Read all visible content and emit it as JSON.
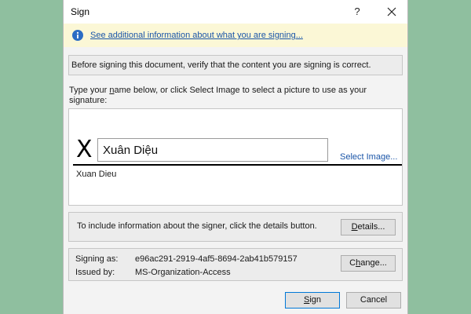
{
  "window": {
    "title": "Sign",
    "help_glyph": "?",
    "close_icon": "close-icon"
  },
  "infobar": {
    "link_text": "See additional information about what you are signing..."
  },
  "verify": {
    "text": "Before signing this document, verify that the content you are signing is correct."
  },
  "instructions": {
    "part1": "Type your ",
    "underlined": "n",
    "part2": "ame below, or click Select Image to select a picture to use as your signature:"
  },
  "signature": {
    "x_mark": "X",
    "input_value": "Xuân Diệu",
    "select_image": "Select Image...",
    "signer_name": "Xuan Dieu"
  },
  "details": {
    "text": "To include information about the signer, click the details button.",
    "button_underlined": "D",
    "button_rest": "etails..."
  },
  "signing": {
    "signing_as_label": "Signing as:",
    "signing_as_value": "e96ac291-2919-4af5-8694-2ab41b579157",
    "issued_by_label": "Issued by:",
    "issued_by_value": "MS-Organization-Access",
    "change_pre": "C",
    "change_underlined": "h",
    "change_post": "ange..."
  },
  "buttons": {
    "sign_underlined": "S",
    "sign_rest": "ign",
    "cancel": "Cancel"
  },
  "colors": {
    "background": "#8fbf9f",
    "link": "#1a55a8",
    "infobar": "#fbf7d6",
    "info_icon": "#2b6cc4"
  }
}
